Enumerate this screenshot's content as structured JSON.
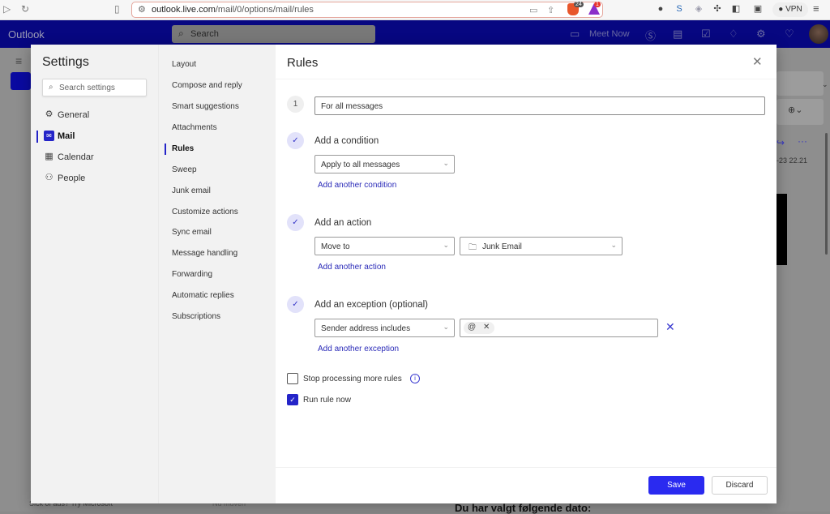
{
  "browser": {
    "url_host": "outlook.live.com",
    "url_path": "/mail/0/options/mail/rules",
    "brave_shield_count": "24",
    "rewards_count": "1",
    "vpn_label": "VPN"
  },
  "outlook_header": {
    "brand": "Outlook",
    "search_placeholder": "Search",
    "meet_now_label": "Meet Now"
  },
  "background": {
    "date_snippet": "-23 22.21",
    "bottom_left_text": "Sick of ads? Try Microsoft",
    "bottom_mid_text": "Nu muven",
    "bottom_right_text": "Du har valgt følgende dato:"
  },
  "settings": {
    "title": "Settings",
    "search_placeholder": "Search settings",
    "categories": [
      {
        "label": "General",
        "icon": "gear-icon",
        "active": false
      },
      {
        "label": "Mail",
        "icon": "mail-icon",
        "active": true
      },
      {
        "label": "Calendar",
        "icon": "calendar-icon",
        "active": false
      },
      {
        "label": "People",
        "icon": "people-icon",
        "active": false
      }
    ],
    "mail_subsections": [
      "Layout",
      "Compose and reply",
      "Smart suggestions",
      "Attachments",
      "Rules",
      "Sweep",
      "Junk email",
      "Customize actions",
      "Sync email",
      "Message handling",
      "Forwarding",
      "Automatic replies",
      "Subscriptions"
    ],
    "active_subsection": "Rules"
  },
  "rules": {
    "title": "Rules",
    "step_number": "1",
    "rule_name": "For all messages",
    "condition": {
      "title": "Add a condition",
      "selected": "Apply to all messages",
      "add_link": "Add another condition"
    },
    "action": {
      "title": "Add an action",
      "selected": "Move to",
      "folder": "Junk Email",
      "add_link": "Add another action"
    },
    "exception": {
      "title": "Add an exception (optional)",
      "selected": "Sender address includes",
      "chip_value": "@",
      "add_link": "Add another exception"
    },
    "stop_processing": {
      "label": "Stop processing more rules",
      "checked": false
    },
    "run_now": {
      "label": "Run rule now",
      "checked": true
    },
    "save_label": "Save",
    "discard_label": "Discard"
  }
}
